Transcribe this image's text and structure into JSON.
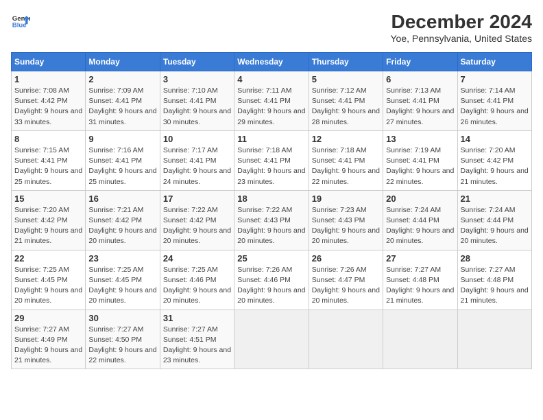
{
  "logo": {
    "line1": "General",
    "line2": "Blue"
  },
  "title": "December 2024",
  "subtitle": "Yoe, Pennsylvania, United States",
  "weekdays": [
    "Sunday",
    "Monday",
    "Tuesday",
    "Wednesday",
    "Thursday",
    "Friday",
    "Saturday"
  ],
  "weeks": [
    [
      {
        "day": "1",
        "sunrise": "7:08 AM",
        "sunset": "4:42 PM",
        "daylight": "9 hours and 33 minutes."
      },
      {
        "day": "2",
        "sunrise": "7:09 AM",
        "sunset": "4:41 PM",
        "daylight": "9 hours and 31 minutes."
      },
      {
        "day": "3",
        "sunrise": "7:10 AM",
        "sunset": "4:41 PM",
        "daylight": "9 hours and 30 minutes."
      },
      {
        "day": "4",
        "sunrise": "7:11 AM",
        "sunset": "4:41 PM",
        "daylight": "9 hours and 29 minutes."
      },
      {
        "day": "5",
        "sunrise": "7:12 AM",
        "sunset": "4:41 PM",
        "daylight": "9 hours and 28 minutes."
      },
      {
        "day": "6",
        "sunrise": "7:13 AM",
        "sunset": "4:41 PM",
        "daylight": "9 hours and 27 minutes."
      },
      {
        "day": "7",
        "sunrise": "7:14 AM",
        "sunset": "4:41 PM",
        "daylight": "9 hours and 26 minutes."
      }
    ],
    [
      {
        "day": "8",
        "sunrise": "7:15 AM",
        "sunset": "4:41 PM",
        "daylight": "9 hours and 25 minutes."
      },
      {
        "day": "9",
        "sunrise": "7:16 AM",
        "sunset": "4:41 PM",
        "daylight": "9 hours and 25 minutes."
      },
      {
        "day": "10",
        "sunrise": "7:17 AM",
        "sunset": "4:41 PM",
        "daylight": "9 hours and 24 minutes."
      },
      {
        "day": "11",
        "sunrise": "7:18 AM",
        "sunset": "4:41 PM",
        "daylight": "9 hours and 23 minutes."
      },
      {
        "day": "12",
        "sunrise": "7:18 AM",
        "sunset": "4:41 PM",
        "daylight": "9 hours and 22 minutes."
      },
      {
        "day": "13",
        "sunrise": "7:19 AM",
        "sunset": "4:41 PM",
        "daylight": "9 hours and 22 minutes."
      },
      {
        "day": "14",
        "sunrise": "7:20 AM",
        "sunset": "4:42 PM",
        "daylight": "9 hours and 21 minutes."
      }
    ],
    [
      {
        "day": "15",
        "sunrise": "7:20 AM",
        "sunset": "4:42 PM",
        "daylight": "9 hours and 21 minutes."
      },
      {
        "day": "16",
        "sunrise": "7:21 AM",
        "sunset": "4:42 PM",
        "daylight": "9 hours and 20 minutes."
      },
      {
        "day": "17",
        "sunrise": "7:22 AM",
        "sunset": "4:42 PM",
        "daylight": "9 hours and 20 minutes."
      },
      {
        "day": "18",
        "sunrise": "7:22 AM",
        "sunset": "4:43 PM",
        "daylight": "9 hours and 20 minutes."
      },
      {
        "day": "19",
        "sunrise": "7:23 AM",
        "sunset": "4:43 PM",
        "daylight": "9 hours and 20 minutes."
      },
      {
        "day": "20",
        "sunrise": "7:24 AM",
        "sunset": "4:44 PM",
        "daylight": "9 hours and 20 minutes."
      },
      {
        "day": "21",
        "sunrise": "7:24 AM",
        "sunset": "4:44 PM",
        "daylight": "9 hours and 20 minutes."
      }
    ],
    [
      {
        "day": "22",
        "sunrise": "7:25 AM",
        "sunset": "4:45 PM",
        "daylight": "9 hours and 20 minutes."
      },
      {
        "day": "23",
        "sunrise": "7:25 AM",
        "sunset": "4:45 PM",
        "daylight": "9 hours and 20 minutes."
      },
      {
        "day": "24",
        "sunrise": "7:25 AM",
        "sunset": "4:46 PM",
        "daylight": "9 hours and 20 minutes."
      },
      {
        "day": "25",
        "sunrise": "7:26 AM",
        "sunset": "4:46 PM",
        "daylight": "9 hours and 20 minutes."
      },
      {
        "day": "26",
        "sunrise": "7:26 AM",
        "sunset": "4:47 PM",
        "daylight": "9 hours and 20 minutes."
      },
      {
        "day": "27",
        "sunrise": "7:27 AM",
        "sunset": "4:48 PM",
        "daylight": "9 hours and 21 minutes."
      },
      {
        "day": "28",
        "sunrise": "7:27 AM",
        "sunset": "4:48 PM",
        "daylight": "9 hours and 21 minutes."
      }
    ],
    [
      {
        "day": "29",
        "sunrise": "7:27 AM",
        "sunset": "4:49 PM",
        "daylight": "9 hours and 21 minutes."
      },
      {
        "day": "30",
        "sunrise": "7:27 AM",
        "sunset": "4:50 PM",
        "daylight": "9 hours and 22 minutes."
      },
      {
        "day": "31",
        "sunrise": "7:27 AM",
        "sunset": "4:51 PM",
        "daylight": "9 hours and 23 minutes."
      },
      null,
      null,
      null,
      null
    ]
  ]
}
